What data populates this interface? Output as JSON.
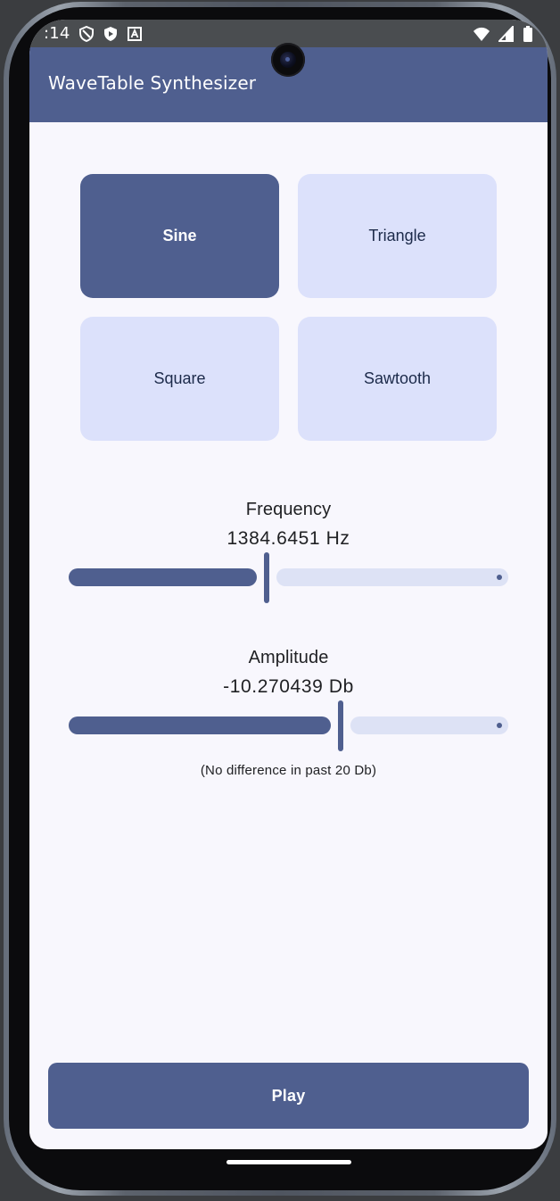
{
  "status_bar": {
    "time": ":14",
    "left_icons": [
      "privacy-shield-icon",
      "shield-play-icon",
      "text-a-icon"
    ],
    "right_icons": [
      "wifi-icon",
      "signal-icon",
      "battery-icon"
    ]
  },
  "app": {
    "title": "WaveTable Synthesizer"
  },
  "waveforms": {
    "selected": "Sine",
    "items": [
      {
        "label": "Sine",
        "selected": true
      },
      {
        "label": "Triangle",
        "selected": false
      },
      {
        "label": "Square",
        "selected": false
      },
      {
        "label": "Sawtooth",
        "selected": false
      }
    ]
  },
  "frequency": {
    "label": "Frequency",
    "value_text": "1384.6451 Hz",
    "slider_fraction": 0.45
  },
  "amplitude": {
    "label": "Amplitude",
    "value_text": "-10.270439 Db",
    "slider_fraction": 0.62,
    "note": "(No difference in past 20 Db)"
  },
  "actions": {
    "play_label": "Play"
  },
  "colors": {
    "primary": "#4f5f8f",
    "container": "#dce1fb",
    "background": "#f8f7fd",
    "inactive_track": "#dde2f5",
    "text": "#202124"
  }
}
